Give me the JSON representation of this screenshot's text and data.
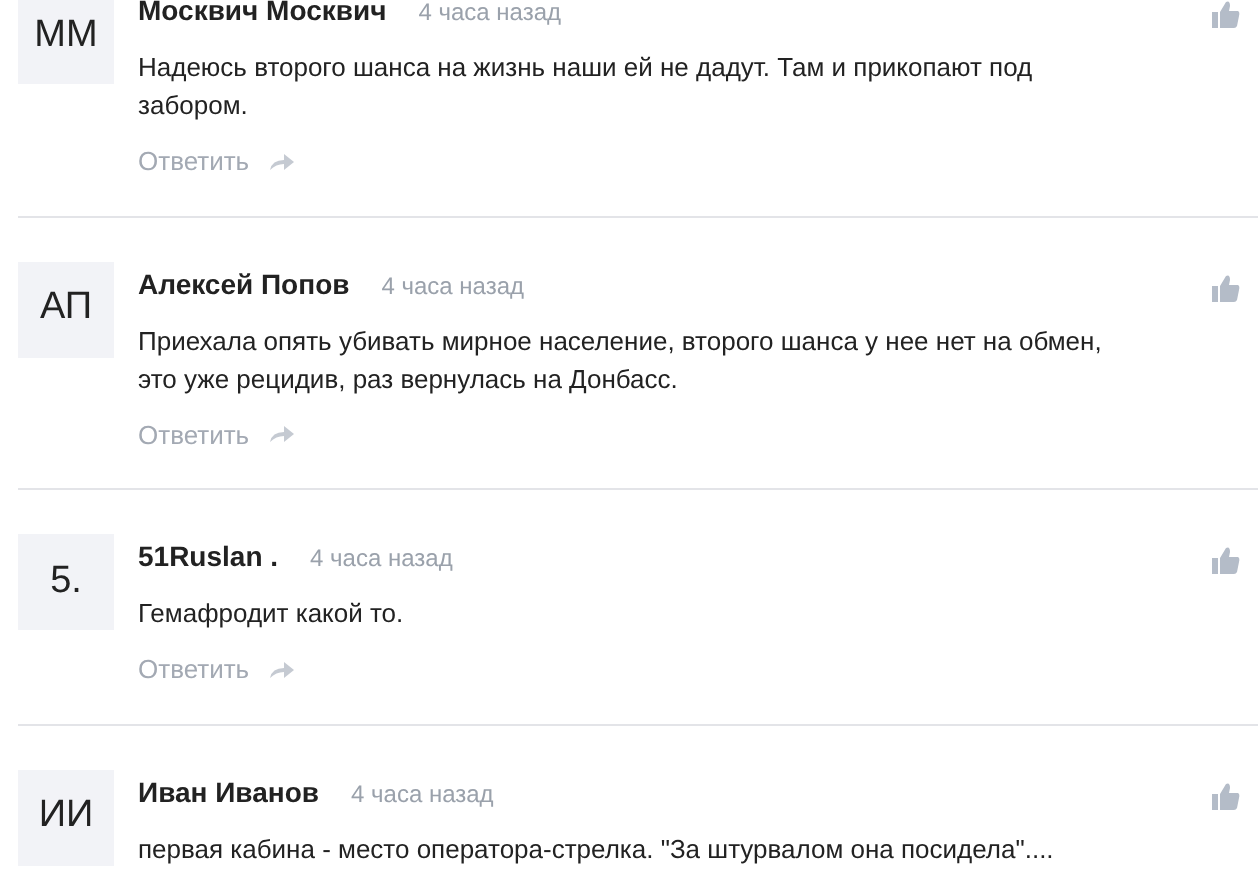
{
  "comments": [
    {
      "avatar": "ММ",
      "author": "Москвич Москвич",
      "time": "4 часа назад",
      "text": "Надеюсь второго шанса на жизнь наши ей не дадут. Там и прикопают под забором.",
      "reply": "Ответить"
    },
    {
      "avatar": "АП",
      "author": "Алексей Попов",
      "time": "4 часа назад",
      "text": "Приехала опять убивать мирное население, второго шанса у нее нет на обмен, это уже рецидив, раз вернулась на Донбасс.",
      "reply": "Ответить"
    },
    {
      "avatar": "5.",
      "author": "51Ruslan .",
      "time": "4 часа назад",
      "text": "Гемафродит какой то.",
      "reply": "Ответить"
    },
    {
      "avatar": "ИИ",
      "author": "Иван Иванов",
      "time": "4 часа назад",
      "text": "первая кабина - место оператора-стрелка. \"За штурвалом она посидела\"...."
    }
  ]
}
